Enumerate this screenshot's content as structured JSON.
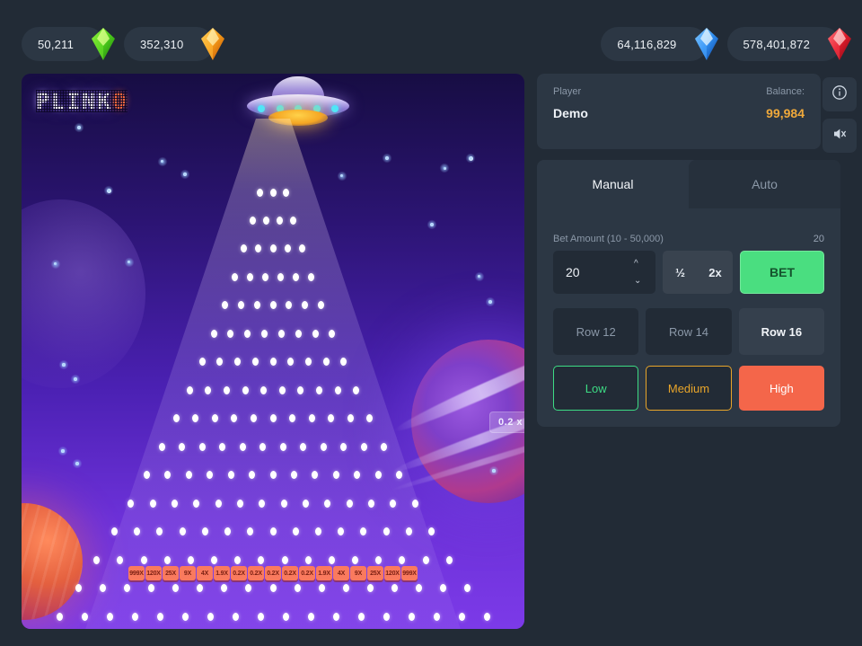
{
  "topbar": {
    "currencies": [
      {
        "value": "50,211",
        "gem": "green-gem-icon",
        "side": "left"
      },
      {
        "value": "352,310",
        "gem": "orange-gem-icon",
        "side": "left"
      },
      {
        "value": "64,116,829",
        "gem": "blue-gem-icon",
        "side": "right"
      },
      {
        "value": "578,401,872",
        "gem": "red-gem-icon",
        "side": "right"
      }
    ]
  },
  "board": {
    "logo_main": "PLINK",
    "logo_accent": "O",
    "ufo_icon": "ufo-icon",
    "result_chip": "0.2 x",
    "multipliers": [
      "999X",
      "120X",
      "25X",
      "9X",
      "4X",
      "1.9X",
      "0.2X",
      "0.2X",
      "0.2X",
      "0.2X",
      "0.2X",
      "1.9X",
      "4X",
      "9X",
      "25X",
      "120X",
      "999X"
    ],
    "pin_rows": 16
  },
  "player": {
    "player_label": "Player",
    "player_name": "Demo",
    "balance_label": "Balance:",
    "balance_value": "99,984",
    "info_icon": "info-icon",
    "sound_icon": "sound-muted-icon"
  },
  "controls": {
    "tabs": [
      {
        "label": "Manual",
        "active": true
      },
      {
        "label": "Auto",
        "active": false
      }
    ],
    "bet_label": "Bet Amount (10 - 50,000)",
    "bet_display": "20",
    "bet_value": "20",
    "bet_placeholder": "20",
    "half_label": "½",
    "double_label": "2x",
    "bet_button": "BET",
    "rows": [
      {
        "label": "Row 12",
        "active": false
      },
      {
        "label": "Row 14",
        "active": false
      },
      {
        "label": "Row 16",
        "active": true
      }
    ],
    "risks": [
      {
        "label": "Low",
        "state": "outline-green"
      },
      {
        "label": "Medium",
        "state": "outline-orange"
      },
      {
        "label": "High",
        "state": "filled-red"
      }
    ]
  },
  "colors": {
    "page_bg": "#222b36",
    "panel_bg": "#2c3744",
    "accent_green": "#4ade80",
    "accent_orange": "#f0a93b",
    "accent_red": "#f4664a",
    "bucket_bg": "#fa7a5e"
  }
}
